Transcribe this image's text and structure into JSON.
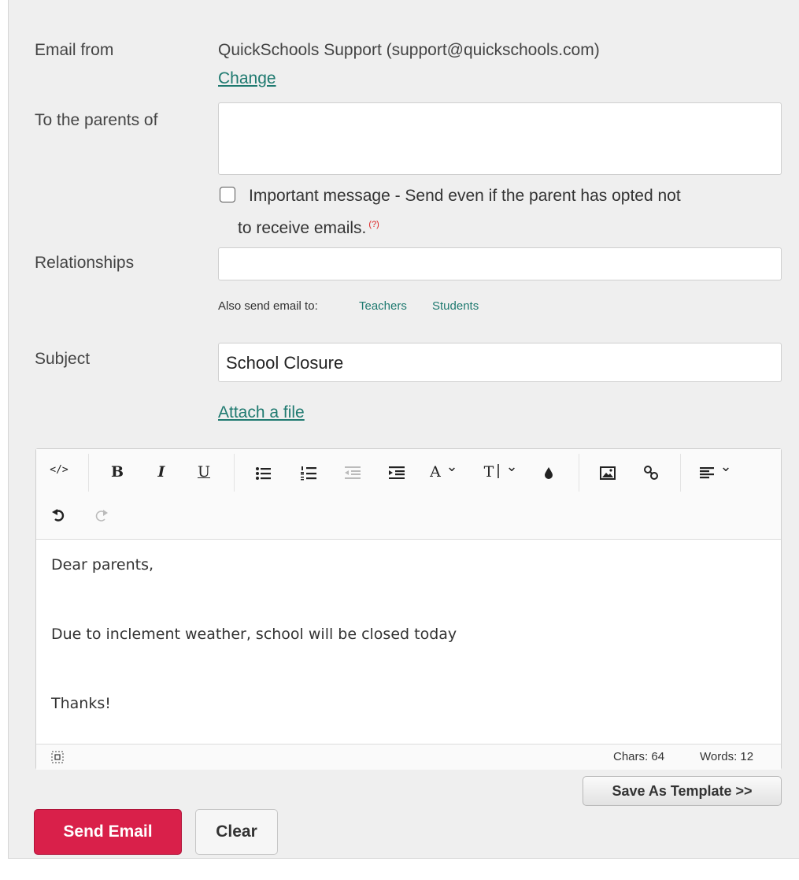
{
  "form": {
    "email_from_label": "Email from",
    "email_from_value": "QuickSchools Support (support@quickschools.com)",
    "change_link": "Change",
    "to_parents_label": "To the parents of",
    "to_parents_value": "",
    "important_checkbox_checked": false,
    "important_line1": "Important message - Send even if the parent has opted not",
    "important_line2": "to receive emails.",
    "help_marker": "(?)",
    "relationships_label": "Relationships",
    "relationships_value": "",
    "also_send_label": "Also send email to:",
    "also_send_teachers": "Teachers",
    "also_send_students": "Students",
    "subject_label": "Subject",
    "subject_value": "School Closure",
    "attach_link": "Attach a file"
  },
  "editor": {
    "toolbar": {
      "code": "</>",
      "bold": "B",
      "italic": "I",
      "underline": "U",
      "font_color": "A",
      "font_size": "T",
      "chevron": "⌄"
    },
    "content": {
      "line1": "Dear parents,",
      "line2": "Due to inclement weather, school will be closed today",
      "line3": "Thanks!"
    },
    "status": {
      "chars": "Chars: 64",
      "words": "Words: 12"
    }
  },
  "buttons": {
    "save_template": "Save As Template >>",
    "send_email": "Send Email",
    "clear": "Clear"
  },
  "colors": {
    "accent_link": "#1f7a70",
    "send_button": "#d9204a",
    "help_marker": "#d22222"
  }
}
